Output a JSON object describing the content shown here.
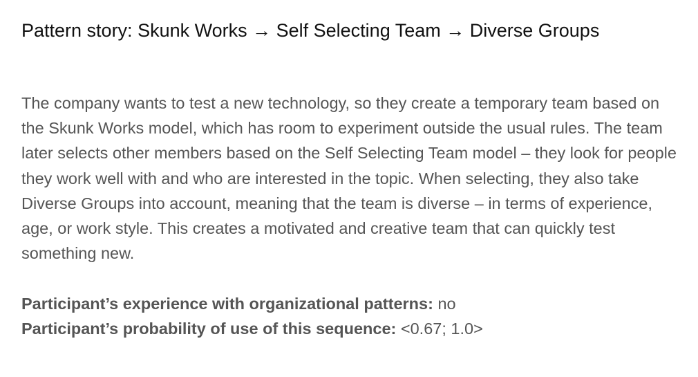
{
  "header": {
    "title": "Pattern story: Skunk Works → Self Selecting Team → Diverse Groups"
  },
  "story": {
    "text": "The company wants to test a new technology, so they create a temporary team based on the Skunk Works model, which has room to experiment outside the usual rules. The team later selects other members based on the Self Selecting Team model – they look for people they work well with and who are interested in the topic. When selecting, they also take Diverse Groups into account, meaning that the team is diverse – in terms of experience, age, or work style. This creates a motivated and creative team that can quickly test something new."
  },
  "meta": {
    "experience_label": "Participant’s experience with organizational patterns:",
    "experience_value": "no",
    "probability_label": "Participant’s probability of use of this sequence:",
    "probability_value": "<0.67; 1.0>"
  }
}
